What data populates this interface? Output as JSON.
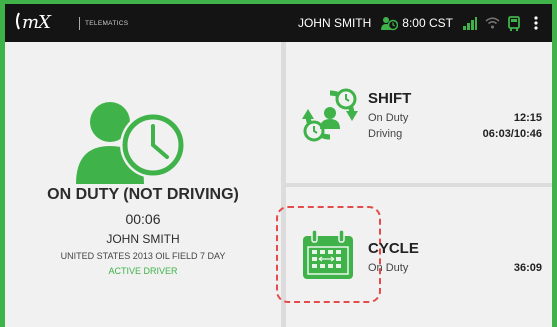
{
  "topbar": {
    "brand": "mX",
    "brand_sub": "TELEMATICS",
    "user_name": "JOHN SMITH",
    "time": "8:00 CST",
    "icons": [
      "driver-clock-icon",
      "signal-icon",
      "wifi-icon",
      "truck-icon",
      "menu-dots-icon"
    ]
  },
  "driver_status": {
    "status": "ON DUTY (NOT DRIVING)",
    "timer": "00:06",
    "name": "JOHN SMITH",
    "ruleset": "UNITED STATES 2013 OIL FIELD 7 DAY",
    "role": "ACTIVE DRIVER",
    "icon": "driver-clock-icon"
  },
  "shift": {
    "title": "SHIFT",
    "on_duty_label": "On Duty",
    "on_duty_value": "12:15",
    "driving_label": "Driving",
    "driving_value": "06:03/10:46",
    "icon": "shift-cycle-icon"
  },
  "cycle": {
    "title": "CYCLE",
    "on_duty_label": "On Duty",
    "on_duty_value": "36:09",
    "icon": "calendar-icon"
  },
  "colors": {
    "accent": "#3fb34a",
    "topbar": "#141414",
    "highlight": "#e44b4b"
  }
}
